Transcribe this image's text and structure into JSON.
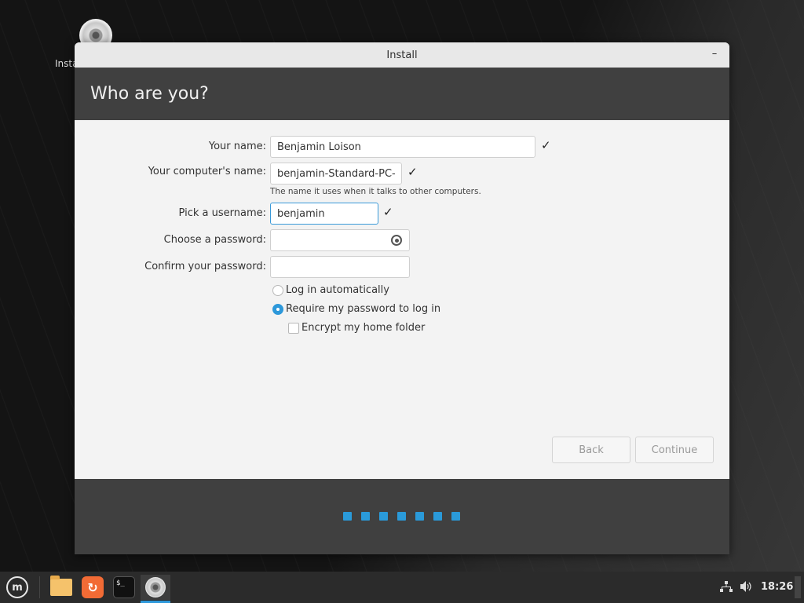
{
  "desktop": {
    "icons": [
      {
        "label": "Install",
        "icon": "cd-icon"
      }
    ]
  },
  "window": {
    "title": "Install",
    "minimize_glyph": "–"
  },
  "header": {
    "title": "Who are you?"
  },
  "form": {
    "your_name": {
      "label": "Your name:",
      "value": "Benjamin Loison",
      "valid": true
    },
    "computer_name": {
      "label": "Your computer's name:",
      "value": "benjamin-Standard-PC-Q",
      "hint": "The name it uses when it talks to other computers.",
      "valid": true
    },
    "username": {
      "label": "Pick a username:",
      "value": "benjamin",
      "valid": true,
      "focused": true
    },
    "password": {
      "label": "Choose a password:",
      "value": "",
      "reveal_icon": "eye-icon"
    },
    "confirm_password": {
      "label": "Confirm your password:",
      "value": ""
    },
    "login_options": [
      {
        "label": "Log in automatically",
        "selected": false
      },
      {
        "label": "Require my password to log in",
        "selected": true
      }
    ],
    "encrypt_home": {
      "label": "Encrypt my home folder",
      "checked": false
    },
    "check_glyph": "✓"
  },
  "buttons": {
    "back": "Back",
    "continue": "Continue"
  },
  "progress": {
    "steps_total": 7,
    "accent": "#2a9ad9"
  },
  "taskbar": {
    "menu_icon": "linux-mint-menu-icon",
    "apps": [
      {
        "name": "files",
        "icon": "folder-icon"
      },
      {
        "name": "firefox",
        "icon": "firefox-icon"
      },
      {
        "name": "terminal",
        "icon": "terminal-icon",
        "glyph": "$_"
      },
      {
        "name": "install",
        "icon": "cd-icon",
        "active": true
      }
    ],
    "tray": {
      "network": "network-icon",
      "volume": "volume-icon",
      "clock": "18:26"
    }
  }
}
